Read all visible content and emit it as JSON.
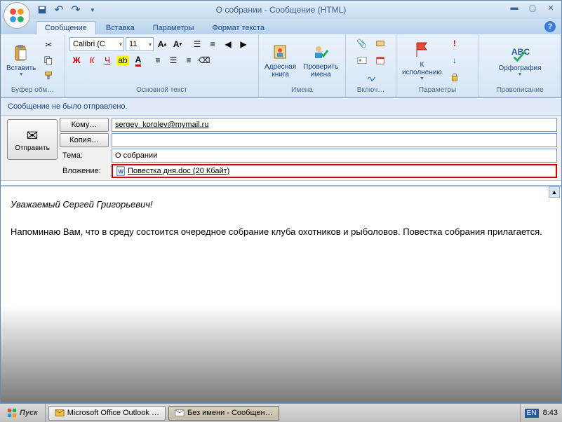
{
  "window": {
    "title": "О собрании - Сообщение (HTML)"
  },
  "tabs": {
    "message": "Сообщение",
    "insert": "Вставка",
    "options": "Параметры",
    "format": "Формат текста"
  },
  "ribbon": {
    "clipboard": {
      "paste": "Вставить",
      "group": "Буфер обм…"
    },
    "font": {
      "family": "Calibri (C",
      "size": "11",
      "group": "Основной текст"
    },
    "names": {
      "addressbook": "Адресная\nкнига",
      "checknames": "Проверить\nимена",
      "group": "Имена"
    },
    "include": {
      "group": "Включ…"
    },
    "followup": {
      "label": "К\nисполнению",
      "group": "Параметры"
    },
    "proofing": {
      "spelling": "Орфография",
      "group": "Правописание"
    }
  },
  "infobar": "Сообщение не было отправлено.",
  "compose": {
    "send": "Отправить",
    "to_btn": "Кому…",
    "to_value": "sergey_korolev@mymail.ru",
    "cc_btn": "Копия…",
    "cc_value": "",
    "subject_label": "Тема:",
    "subject_value": "О собрании",
    "attach_label": "Вложение:",
    "attach_file": "Повестка дня.doc (20 Кбайт)"
  },
  "body": {
    "greeting": "Уважаемый Сергей Григорьевич!",
    "para": "Напоминаю  Вам, что в среду состоится очередное собрание клуба охотников и рыболовов. Повестка собрания прилагается."
  },
  "taskbar": {
    "start": "Пуск",
    "task1": "Microsoft Office Outlook …",
    "task2": "Без имени - Сообщен…",
    "lang": "EN",
    "clock": "8:43"
  }
}
